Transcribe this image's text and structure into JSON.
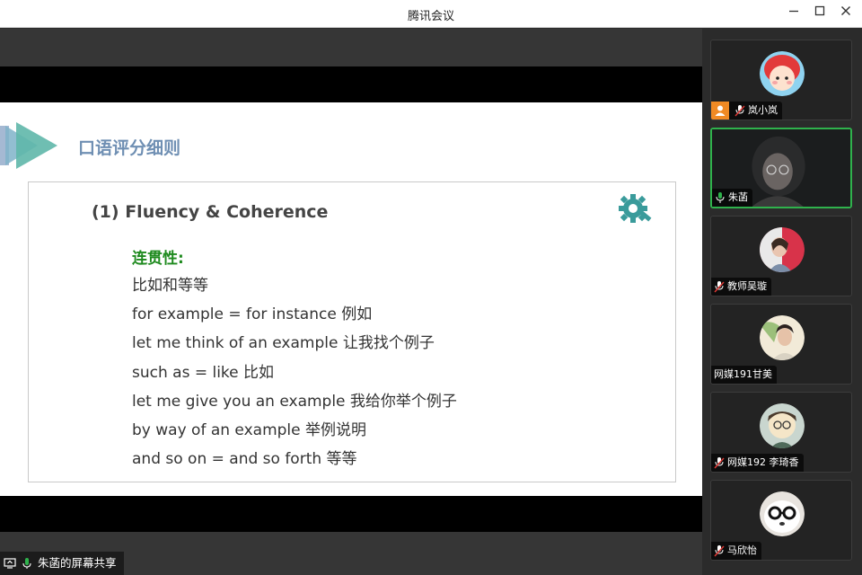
{
  "window": {
    "title": "腾讯会议"
  },
  "slide": {
    "heading": "口语评分细则",
    "sub_heading": "(1) Fluency & Coherence",
    "section_label": "连贯性:",
    "lines": [
      "比如和等等",
      "for example = for instance 例如",
      "let me think of an example 让我找个例子",
      "such as = like 比如",
      "let me give you an example 我给你举个例子",
      "by way of an example 举例说明",
      "and so on = and so forth 等等"
    ]
  },
  "share_status": {
    "text": "朱菡的屏幕共享"
  },
  "participants": [
    {
      "name": "岚小岚",
      "host": true,
      "mic": "muted"
    },
    {
      "name": "朱菡",
      "host": false,
      "mic": "active",
      "speaking": true
    },
    {
      "name": "教师吴璇",
      "host": false,
      "mic": "muted"
    },
    {
      "name": "网媒191甘美",
      "host": false,
      "mic": "none"
    },
    {
      "name": "网媒192 李琦香",
      "host": false,
      "mic": "muted"
    },
    {
      "name": "马欣怡",
      "host": false,
      "mic": "muted"
    }
  ],
  "colors": {
    "accent_green": "#2fb24c",
    "heading_blue": "#6f8fb3",
    "label_green": "#1e8a1e",
    "host_orange": "#f08a24"
  },
  "icons": {
    "minimize": "minimize-icon",
    "maximize": "maximize-icon",
    "close": "close-icon",
    "gear": "gear-wrench-icon",
    "mic": "microphone-icon",
    "host": "host-user-icon",
    "screen": "screen-share-icon"
  }
}
